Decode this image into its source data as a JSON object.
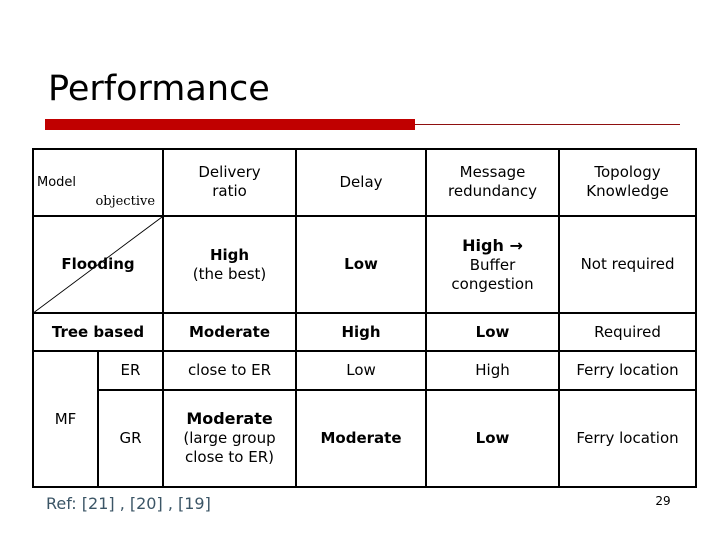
{
  "slide": {
    "title": "Performance",
    "page_number": "29",
    "reference": "Ref: [21] , [20] , [19]",
    "accent_color": "#c00000",
    "rule_thin_color": "#8f1010",
    "reference_color": "#3b5566"
  },
  "table": {
    "header": {
      "model_label": "Model",
      "objective_label": "objective",
      "columns": [
        "Delivery ratio",
        "Delay",
        "Message redundancy",
        "Topology Knowledge"
      ],
      "columns_lines": [
        [
          "Delivery",
          "ratio"
        ],
        [
          "Delay"
        ],
        [
          "Message",
          "redundancy"
        ],
        [
          "Topology",
          "Knowledge"
        ]
      ]
    },
    "rows": [
      {
        "model": "Flooding",
        "has_diagonal": true,
        "delivery_ratio_main": "High",
        "delivery_ratio_sub": "(the best)",
        "delay": "Low",
        "message_redundancy_main": "High →",
        "message_redundancy_sub_1": "Buffer",
        "message_redundancy_sub_2": "congestion",
        "topology_knowledge": "Not required"
      },
      {
        "model": "Tree based",
        "has_diagonal": false,
        "delivery_ratio_main": "Moderate",
        "delivery_ratio_sub": "",
        "delay": "High",
        "message_redundancy_main": "Low",
        "message_redundancy_sub_1": "",
        "message_redundancy_sub_2": "",
        "topology_knowledge": "Required"
      }
    ],
    "mf_group": {
      "label": "MF",
      "subrows": [
        {
          "sub_label": "ER",
          "delivery_ratio_main": "close to ER",
          "delivery_ratio_sub_1": "",
          "delivery_ratio_sub_2": "",
          "delay": "Low",
          "message_redundancy": "High",
          "topology_knowledge": "Ferry location"
        },
        {
          "sub_label": "GR",
          "delivery_ratio_main": "Moderate",
          "delivery_ratio_sub_1": "(large group",
          "delivery_ratio_sub_2": "close to ER)",
          "delay": "Moderate",
          "message_redundancy": "Low",
          "topology_knowledge": "Ferry location"
        }
      ]
    }
  }
}
